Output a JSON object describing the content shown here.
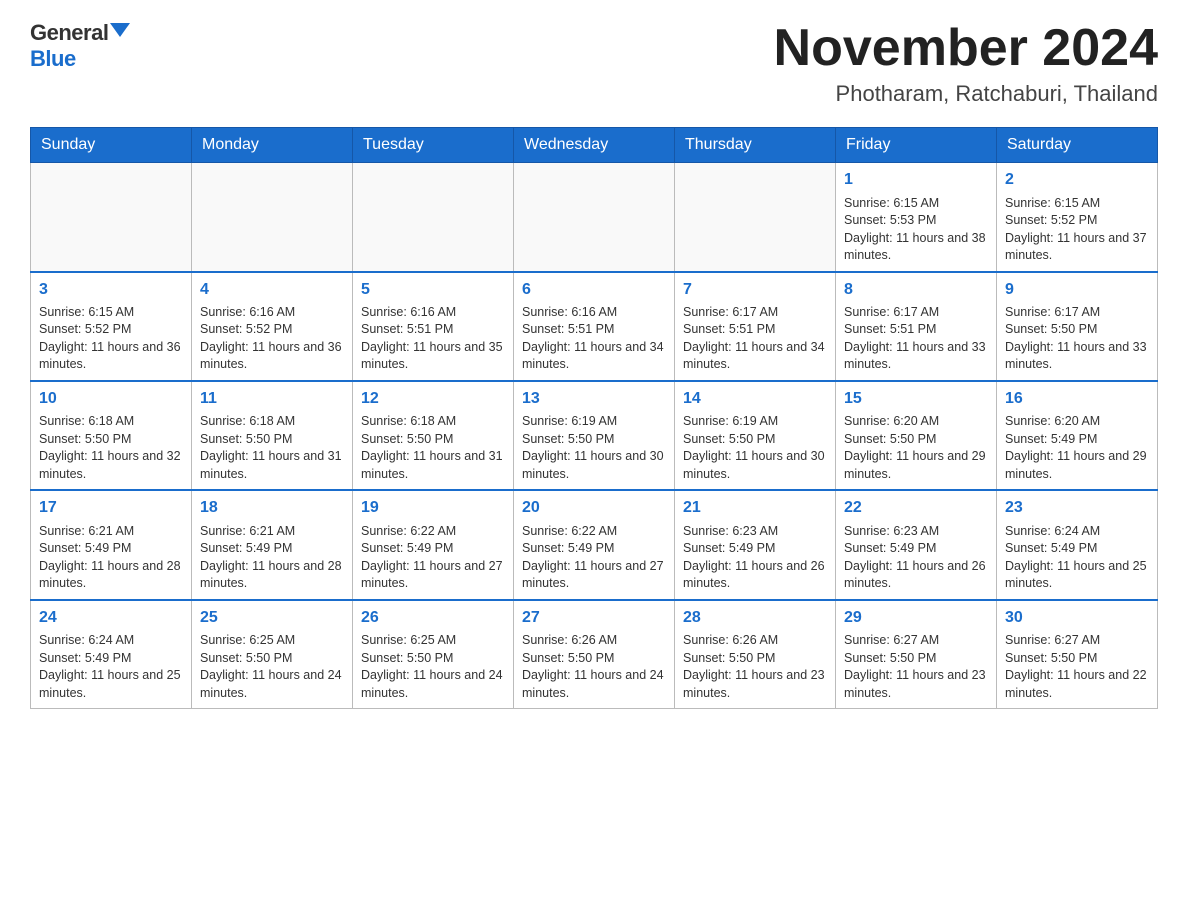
{
  "header": {
    "logo_general": "General",
    "logo_blue": "Blue",
    "title": "November 2024",
    "location": "Photharam, Ratchaburi, Thailand"
  },
  "weekdays": [
    "Sunday",
    "Monday",
    "Tuesday",
    "Wednesday",
    "Thursday",
    "Friday",
    "Saturday"
  ],
  "weeks": [
    [
      {
        "day": "",
        "info": ""
      },
      {
        "day": "",
        "info": ""
      },
      {
        "day": "",
        "info": ""
      },
      {
        "day": "",
        "info": ""
      },
      {
        "day": "",
        "info": ""
      },
      {
        "day": "1",
        "info": "Sunrise: 6:15 AM\nSunset: 5:53 PM\nDaylight: 11 hours and 38 minutes."
      },
      {
        "day": "2",
        "info": "Sunrise: 6:15 AM\nSunset: 5:52 PM\nDaylight: 11 hours and 37 minutes."
      }
    ],
    [
      {
        "day": "3",
        "info": "Sunrise: 6:15 AM\nSunset: 5:52 PM\nDaylight: 11 hours and 36 minutes."
      },
      {
        "day": "4",
        "info": "Sunrise: 6:16 AM\nSunset: 5:52 PM\nDaylight: 11 hours and 36 minutes."
      },
      {
        "day": "5",
        "info": "Sunrise: 6:16 AM\nSunset: 5:51 PM\nDaylight: 11 hours and 35 minutes."
      },
      {
        "day": "6",
        "info": "Sunrise: 6:16 AM\nSunset: 5:51 PM\nDaylight: 11 hours and 34 minutes."
      },
      {
        "day": "7",
        "info": "Sunrise: 6:17 AM\nSunset: 5:51 PM\nDaylight: 11 hours and 34 minutes."
      },
      {
        "day": "8",
        "info": "Sunrise: 6:17 AM\nSunset: 5:51 PM\nDaylight: 11 hours and 33 minutes."
      },
      {
        "day": "9",
        "info": "Sunrise: 6:17 AM\nSunset: 5:50 PM\nDaylight: 11 hours and 33 minutes."
      }
    ],
    [
      {
        "day": "10",
        "info": "Sunrise: 6:18 AM\nSunset: 5:50 PM\nDaylight: 11 hours and 32 minutes."
      },
      {
        "day": "11",
        "info": "Sunrise: 6:18 AM\nSunset: 5:50 PM\nDaylight: 11 hours and 31 minutes."
      },
      {
        "day": "12",
        "info": "Sunrise: 6:18 AM\nSunset: 5:50 PM\nDaylight: 11 hours and 31 minutes."
      },
      {
        "day": "13",
        "info": "Sunrise: 6:19 AM\nSunset: 5:50 PM\nDaylight: 11 hours and 30 minutes."
      },
      {
        "day": "14",
        "info": "Sunrise: 6:19 AM\nSunset: 5:50 PM\nDaylight: 11 hours and 30 minutes."
      },
      {
        "day": "15",
        "info": "Sunrise: 6:20 AM\nSunset: 5:50 PM\nDaylight: 11 hours and 29 minutes."
      },
      {
        "day": "16",
        "info": "Sunrise: 6:20 AM\nSunset: 5:49 PM\nDaylight: 11 hours and 29 minutes."
      }
    ],
    [
      {
        "day": "17",
        "info": "Sunrise: 6:21 AM\nSunset: 5:49 PM\nDaylight: 11 hours and 28 minutes."
      },
      {
        "day": "18",
        "info": "Sunrise: 6:21 AM\nSunset: 5:49 PM\nDaylight: 11 hours and 28 minutes."
      },
      {
        "day": "19",
        "info": "Sunrise: 6:22 AM\nSunset: 5:49 PM\nDaylight: 11 hours and 27 minutes."
      },
      {
        "day": "20",
        "info": "Sunrise: 6:22 AM\nSunset: 5:49 PM\nDaylight: 11 hours and 27 minutes."
      },
      {
        "day": "21",
        "info": "Sunrise: 6:23 AM\nSunset: 5:49 PM\nDaylight: 11 hours and 26 minutes."
      },
      {
        "day": "22",
        "info": "Sunrise: 6:23 AM\nSunset: 5:49 PM\nDaylight: 11 hours and 26 minutes."
      },
      {
        "day": "23",
        "info": "Sunrise: 6:24 AM\nSunset: 5:49 PM\nDaylight: 11 hours and 25 minutes."
      }
    ],
    [
      {
        "day": "24",
        "info": "Sunrise: 6:24 AM\nSunset: 5:49 PM\nDaylight: 11 hours and 25 minutes."
      },
      {
        "day": "25",
        "info": "Sunrise: 6:25 AM\nSunset: 5:50 PM\nDaylight: 11 hours and 24 minutes."
      },
      {
        "day": "26",
        "info": "Sunrise: 6:25 AM\nSunset: 5:50 PM\nDaylight: 11 hours and 24 minutes."
      },
      {
        "day": "27",
        "info": "Sunrise: 6:26 AM\nSunset: 5:50 PM\nDaylight: 11 hours and 24 minutes."
      },
      {
        "day": "28",
        "info": "Sunrise: 6:26 AM\nSunset: 5:50 PM\nDaylight: 11 hours and 23 minutes."
      },
      {
        "day": "29",
        "info": "Sunrise: 6:27 AM\nSunset: 5:50 PM\nDaylight: 11 hours and 23 minutes."
      },
      {
        "day": "30",
        "info": "Sunrise: 6:27 AM\nSunset: 5:50 PM\nDaylight: 11 hours and 22 minutes."
      }
    ]
  ]
}
